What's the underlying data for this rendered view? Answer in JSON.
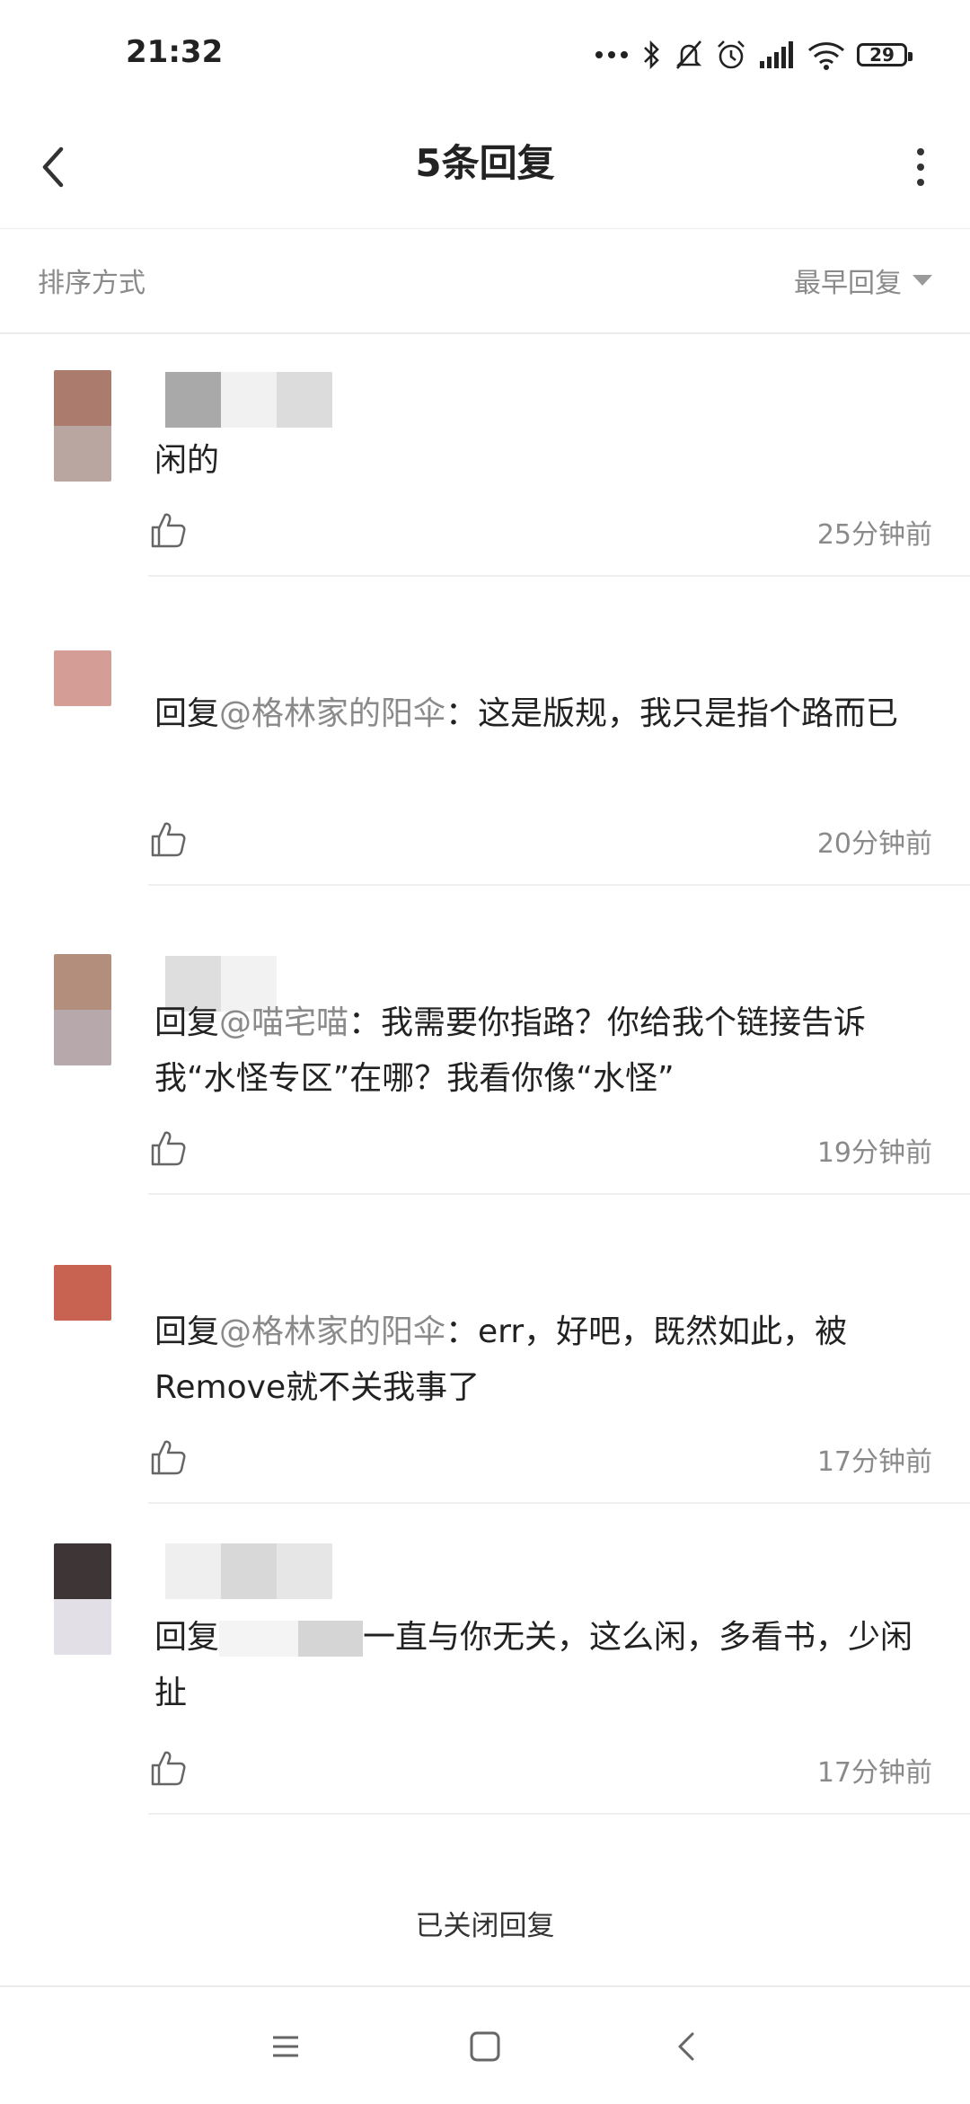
{
  "status_bar": {
    "time": "21:32",
    "battery": "29"
  },
  "header": {
    "title": "5条回复"
  },
  "sort": {
    "label": "排序方式",
    "value": "最早回复"
  },
  "comments": [
    {
      "prefix": "",
      "mention": "",
      "text": "闲的",
      "time": "25分钟前"
    },
    {
      "prefix": "回复",
      "mention": "@格林家的阳伞",
      "text": "：这是版规，我只是指个路而已",
      "time": "20分钟前"
    },
    {
      "prefix": "回复",
      "mention": "@喵宅喵",
      "text": "：我需要你指路？你给我个链接告诉我“水怪专区”在哪？我看你像“水怪”",
      "time": "19分钟前"
    },
    {
      "prefix": "回复",
      "mention": "@格林家的阳伞",
      "text": "：err，好吧，既然如此，被Remove就不关我事了",
      "time": "17分钟前"
    },
    {
      "prefix": "回复",
      "mention": "",
      "text": "一直与你无关，这么闲，多看书，少闲扯",
      "time": "17分钟前"
    }
  ],
  "footer": {
    "closed_text": "已关闭回复"
  },
  "colors": {
    "accent_gray": "#8a8a8a",
    "divider": "#efefef"
  }
}
